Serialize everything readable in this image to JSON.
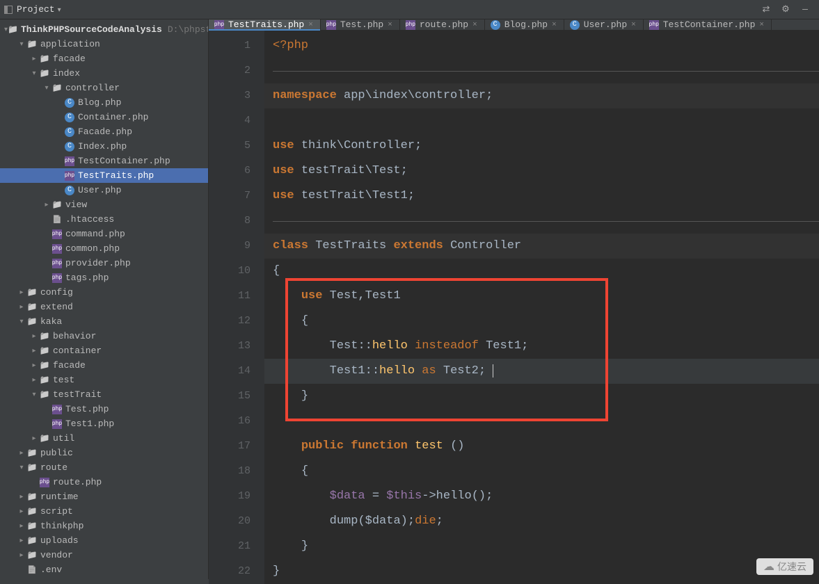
{
  "toolbar": {
    "project_label": "Project",
    "settings_icon": "gear",
    "collapse_icon": "collapse",
    "minimize_icon": "minimize"
  },
  "tabs": [
    {
      "label": "TestTraits.php",
      "icon": "php",
      "active": true
    },
    {
      "label": "Test.php",
      "icon": "php",
      "active": false
    },
    {
      "label": "route.php",
      "icon": "php",
      "active": false
    },
    {
      "label": "Blog.php",
      "icon": "c",
      "active": false
    },
    {
      "label": "User.php",
      "icon": "c",
      "active": false
    },
    {
      "label": "TestContainer.php",
      "icon": "php",
      "active": false
    }
  ],
  "tree": {
    "root": {
      "name": "ThinkPHPSourceCodeAnalysis",
      "path": "D:\\phpstudy"
    },
    "items": [
      {
        "d": 0,
        "arrow": "open",
        "icon": "folder",
        "label_key": "root_name",
        "path_key": "root_path"
      },
      {
        "d": 1,
        "arrow": "open",
        "icon": "folder",
        "label": "application"
      },
      {
        "d": 2,
        "arrow": "closed",
        "icon": "folder",
        "label": "facade"
      },
      {
        "d": 2,
        "arrow": "open",
        "icon": "folder",
        "label": "index"
      },
      {
        "d": 3,
        "arrow": "open",
        "icon": "folder",
        "label": "controller"
      },
      {
        "d": 4,
        "arrow": "none",
        "icon": "c",
        "label": "Blog.php"
      },
      {
        "d": 4,
        "arrow": "none",
        "icon": "c",
        "label": "Container.php"
      },
      {
        "d": 4,
        "arrow": "none",
        "icon": "c",
        "label": "Facade.php"
      },
      {
        "d": 4,
        "arrow": "none",
        "icon": "c",
        "label": "Index.php"
      },
      {
        "d": 4,
        "arrow": "none",
        "icon": "php",
        "label": "TestContainer.php"
      },
      {
        "d": 4,
        "arrow": "none",
        "icon": "php",
        "label": "TestTraits.php",
        "selected": true
      },
      {
        "d": 4,
        "arrow": "none",
        "icon": "c",
        "label": "User.php"
      },
      {
        "d": 3,
        "arrow": "closed",
        "icon": "folder",
        "label": "view"
      },
      {
        "d": 3,
        "arrow": "none",
        "icon": "file",
        "label": ".htaccess"
      },
      {
        "d": 3,
        "arrow": "none",
        "icon": "php",
        "label": "command.php"
      },
      {
        "d": 3,
        "arrow": "none",
        "icon": "php",
        "label": "common.php"
      },
      {
        "d": 3,
        "arrow": "none",
        "icon": "php",
        "label": "provider.php"
      },
      {
        "d": 3,
        "arrow": "none",
        "icon": "php",
        "label": "tags.php"
      },
      {
        "d": 1,
        "arrow": "closed",
        "icon": "folder",
        "label": "config"
      },
      {
        "d": 1,
        "arrow": "closed",
        "icon": "folder",
        "label": "extend"
      },
      {
        "d": 1,
        "arrow": "open",
        "icon": "folder",
        "label": "kaka"
      },
      {
        "d": 2,
        "arrow": "closed",
        "icon": "folder",
        "label": "behavior"
      },
      {
        "d": 2,
        "arrow": "closed",
        "icon": "folder",
        "label": "container"
      },
      {
        "d": 2,
        "arrow": "closed",
        "icon": "folder",
        "label": "facade"
      },
      {
        "d": 2,
        "arrow": "closed",
        "icon": "folder",
        "label": "test"
      },
      {
        "d": 2,
        "arrow": "open",
        "icon": "folder",
        "label": "testTrait"
      },
      {
        "d": 3,
        "arrow": "none",
        "icon": "php",
        "label": "Test.php"
      },
      {
        "d": 3,
        "arrow": "none",
        "icon": "php",
        "label": "Test1.php"
      },
      {
        "d": 2,
        "arrow": "closed",
        "icon": "folder",
        "label": "util"
      },
      {
        "d": 1,
        "arrow": "closed",
        "icon": "folder",
        "label": "public"
      },
      {
        "d": 1,
        "arrow": "open",
        "icon": "folder",
        "label": "route"
      },
      {
        "d": 2,
        "arrow": "none",
        "icon": "php",
        "label": "route.php"
      },
      {
        "d": 1,
        "arrow": "closed",
        "icon": "folder",
        "label": "runtime"
      },
      {
        "d": 1,
        "arrow": "closed",
        "icon": "folder",
        "label": "script"
      },
      {
        "d": 1,
        "arrow": "closed",
        "icon": "folder",
        "label": "thinkphp"
      },
      {
        "d": 1,
        "arrow": "closed",
        "icon": "folder",
        "label": "uploads"
      },
      {
        "d": 1,
        "arrow": "closed",
        "icon": "folder",
        "label": "vendor"
      },
      {
        "d": 1,
        "arrow": "none",
        "icon": "file",
        "label": ".env"
      }
    ]
  },
  "code": {
    "lines": 22,
    "php_open": "<?php",
    "ns_kw": "namespace",
    "ns_body": "app\\index\\controller",
    "use_kw": "use",
    "use1": "think\\Controller",
    "use2": "testTrait\\Test",
    "use3": "testTrait\\Test1",
    "class_kw": "class",
    "class_name": "TestTraits",
    "extends_kw": "extends",
    "parent": "Controller",
    "ob": "{",
    "cb": "}",
    "inner_use": "Test,Test1",
    "l13_a": "Test",
    "dcolon": "::",
    "hello": "hello",
    "insteadof_kw": "insteadof",
    "l13_b": "Test1",
    "l14_a": "Test1",
    "as_kw": "as",
    "l14_b": "Test2",
    "public_kw": "public",
    "function_kw": "function",
    "fn_name": "test",
    "paren": "()",
    "data_var": "$data",
    "eq": " = ",
    "this_var": "$this",
    "arrow": "->",
    "call": "();",
    "dump": "dump",
    "dump_arg": "($data);",
    "die_kw": "die",
    "semi": ";"
  },
  "watermark": "亿速云"
}
